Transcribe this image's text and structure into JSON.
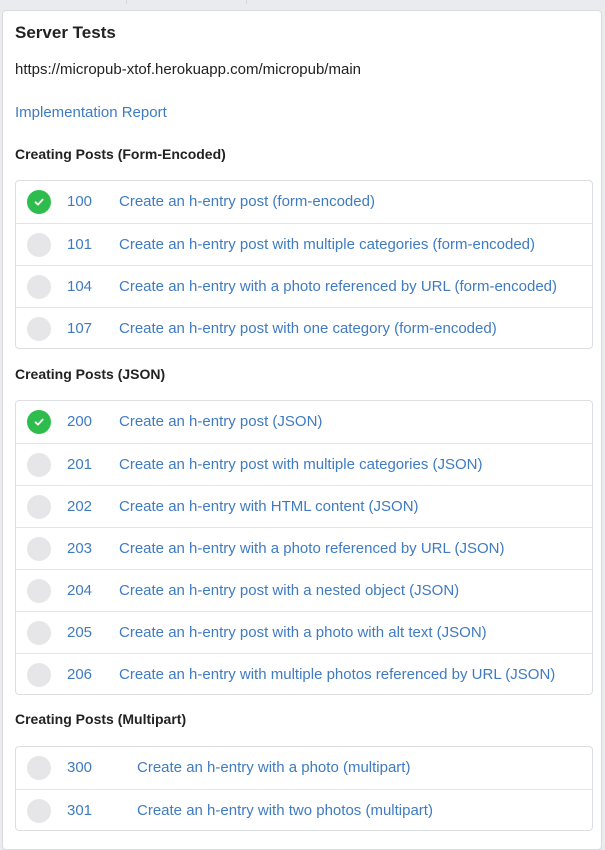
{
  "page": {
    "title": "Server Tests",
    "endpoint": "https://micropub-xtof.herokuapp.com/micropub/main",
    "report_link": "Implementation Report"
  },
  "colors": {
    "link": "#3f7bc2",
    "pass": "#2ebd4d",
    "pending": "#e6e6e8"
  },
  "sections": [
    {
      "heading": "Creating Posts (Form-Encoded)",
      "tests": [
        {
          "number": "100",
          "name": "Create an h-entry post (form-encoded)",
          "status": "passed",
          "icon": "check-icon"
        },
        {
          "number": "101",
          "name": "Create an h-entry post with multiple categories (form-encoded)",
          "status": "not-run",
          "icon": "pending-circle-icon"
        },
        {
          "number": "104",
          "name": "Create an h-entry with a photo referenced by URL (form-encoded)",
          "status": "not-run",
          "icon": "pending-circle-icon"
        },
        {
          "number": "107",
          "name": "Create an h-entry post with one category (form-encoded)",
          "status": "not-run",
          "icon": "pending-circle-icon"
        }
      ]
    },
    {
      "heading": "Creating Posts (JSON)",
      "tests": [
        {
          "number": "200",
          "name": "Create an h-entry post (JSON)",
          "status": "passed",
          "icon": "check-icon"
        },
        {
          "number": "201",
          "name": "Create an h-entry post with multiple categories (JSON)",
          "status": "not-run",
          "icon": "pending-circle-icon"
        },
        {
          "number": "202",
          "name": "Create an h-entry with HTML content (JSON)",
          "status": "not-run",
          "icon": "pending-circle-icon"
        },
        {
          "number": "203",
          "name": "Create an h-entry with a photo referenced by URL (JSON)",
          "status": "not-run",
          "icon": "pending-circle-icon"
        },
        {
          "number": "204",
          "name": "Create an h-entry post with a nested object (JSON)",
          "status": "not-run",
          "icon": "pending-circle-icon"
        },
        {
          "number": "205",
          "name": "Create an h-entry post with a photo with alt text (JSON)",
          "status": "not-run",
          "icon": "pending-circle-icon"
        },
        {
          "number": "206",
          "name": "Create an h-entry with multiple photos referenced by URL (JSON)",
          "status": "not-run",
          "icon": "pending-circle-icon"
        }
      ]
    },
    {
      "heading": "Creating Posts (Multipart)",
      "tests": [
        {
          "number": "300",
          "name": "Create an h-entry with a photo (multipart)",
          "status": "not-run",
          "icon": "pending-circle-icon"
        },
        {
          "number": "301",
          "name": "Create an h-entry with two photos (multipart)",
          "status": "not-run",
          "icon": "pending-circle-icon"
        }
      ]
    }
  ]
}
